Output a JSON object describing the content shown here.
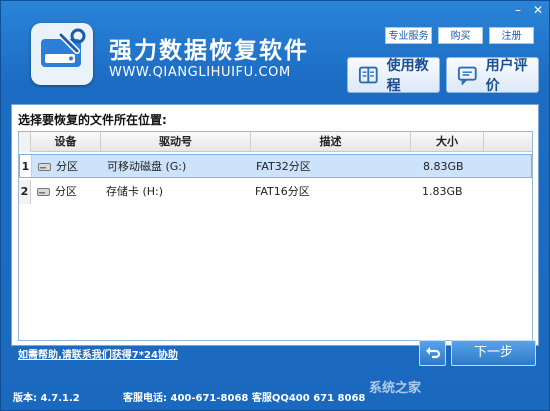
{
  "app": {
    "title": "强力数据恢复软件",
    "url": "WWW.QIANGLIHUIFU.COM"
  },
  "top_links": [
    "专业服务",
    "购买",
    "注册"
  ],
  "window_controls": {
    "minimize": "–",
    "close": "✕"
  },
  "buttons": {
    "tutorial": "使用教程",
    "review": "用户评价",
    "next": "下一步"
  },
  "panel": {
    "title": "选择要恢复的文件所在位置:"
  },
  "table": {
    "headers": [
      "设备",
      "驱动号",
      "描述",
      "大小"
    ],
    "rows": [
      {
        "index": "1",
        "device": "分区",
        "drive": "可移动磁盘 (G:)",
        "desc": "FAT32分区",
        "size": "8.83GB"
      },
      {
        "index": "2",
        "device": "分区",
        "drive": "存储卡 (H:)",
        "desc": "FAT16分区",
        "size": "1.83GB"
      }
    ]
  },
  "help_link": "如需帮助,请联系我们获得7*24协助",
  "footer": {
    "version": "版本: 4.7.1.2",
    "phone": "客服电话: 400-671-8068 客服QQ400 671 8068"
  },
  "watermark": "系统之家",
  "icons": [
    "logo-drive-icon",
    "tutorial-book-icon",
    "review-chat-icon",
    "drive-icon",
    "back-arrow-icon"
  ],
  "colors": {
    "accent": "#1b6dc1",
    "selected_row": "#cde3fb"
  }
}
